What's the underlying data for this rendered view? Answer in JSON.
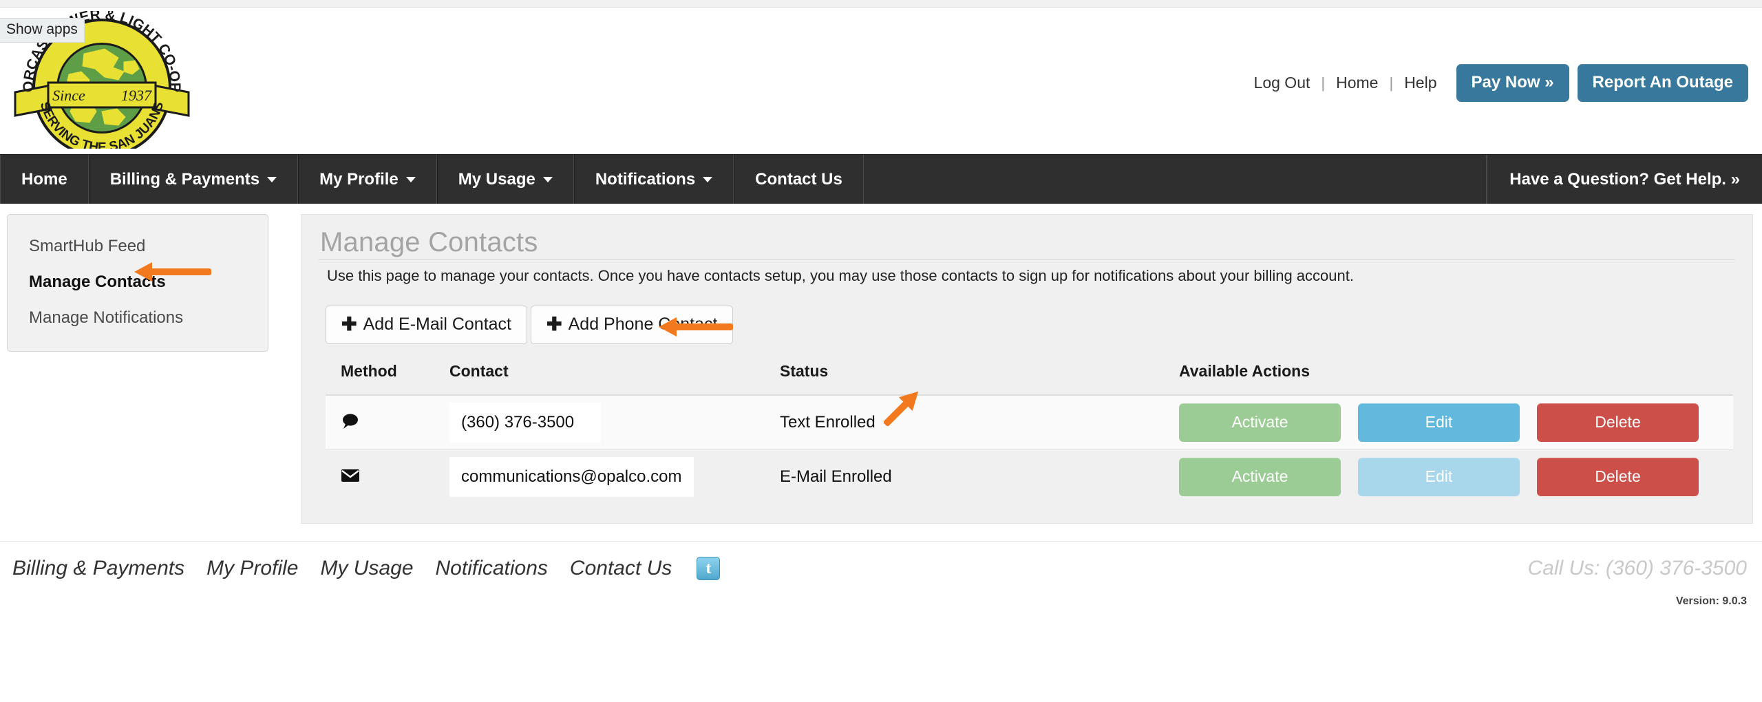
{
  "browser": {
    "tooltip": "Show apps"
  },
  "header": {
    "logo": {
      "top_arc": "ORCAS POWER & LIGHT CO-OP",
      "bottom_arc": "SERVING THE SAN JUANS",
      "ribbon_left": "Since",
      "ribbon_right": "1937"
    },
    "util_links": [
      {
        "label": "Log Out",
        "name": "log-out-link"
      },
      {
        "label": "Home",
        "name": "home-link"
      },
      {
        "label": "Help",
        "name": "help-link"
      }
    ],
    "separator": "|",
    "pay_now_label": "Pay Now »",
    "report_outage_label": "Report An Outage",
    "button_color": "#37789c"
  },
  "mainnav": {
    "items": [
      {
        "label": "Home",
        "caret": false
      },
      {
        "label": "Billing & Payments",
        "caret": true
      },
      {
        "label": "My Profile",
        "caret": true
      },
      {
        "label": "My Usage",
        "caret": true
      },
      {
        "label": "Notifications",
        "caret": true
      },
      {
        "label": "Contact Us",
        "caret": false
      }
    ],
    "help_label": "Have a Question? Get Help. »",
    "background": "#302f2f"
  },
  "sidebar": {
    "items": [
      {
        "label": "SmartHub Feed",
        "active": false
      },
      {
        "label": "Manage Contacts",
        "active": true
      },
      {
        "label": "Manage Notifications",
        "active": false
      }
    ]
  },
  "main": {
    "title": "Manage Contacts",
    "description": "Use this page to manage your contacts. Once you have contacts setup, you may use those contacts to sign up for notifications about your billing account.",
    "add_email_label": "Add E-Mail Contact",
    "add_phone_label": "Add Phone Contact",
    "plus_glyph": "✚",
    "table": {
      "headers": [
        "Method",
        "Contact",
        "Status",
        "Available Actions"
      ],
      "rows": [
        {
          "method_icon": "comment-icon",
          "method_glyph": "🗨",
          "contact": "(360) 376-3500",
          "status": "Text Enrolled",
          "actions": [
            {
              "label": "Activate",
              "style": "activate"
            },
            {
              "label": "Edit",
              "style": "edit"
            },
            {
              "label": "Delete",
              "style": "delete"
            }
          ]
        },
        {
          "method_icon": "envelope-icon",
          "method_glyph": "✉",
          "contact": "communications@opalco.com",
          "status": "E-Mail Enrolled",
          "actions": [
            {
              "label": "Activate",
              "style": "activate"
            },
            {
              "label": "Edit",
              "style": "edit-dim"
            },
            {
              "label": "Delete",
              "style": "delete"
            }
          ]
        }
      ]
    }
  },
  "annotations": {
    "color": "#f2791d",
    "arrows": [
      {
        "target": "sidebar-item-manage-contacts"
      },
      {
        "target": "add-phone-contact-button"
      },
      {
        "target": "status-text-row-0"
      }
    ]
  },
  "footer": {
    "links": [
      "Billing & Payments",
      "My Profile",
      "My Usage",
      "Notifications",
      "Contact Us"
    ],
    "twitter_glyph": "t",
    "call_us": "Call Us: (360) 376-3500",
    "version": "Version: 9.0.3"
  }
}
